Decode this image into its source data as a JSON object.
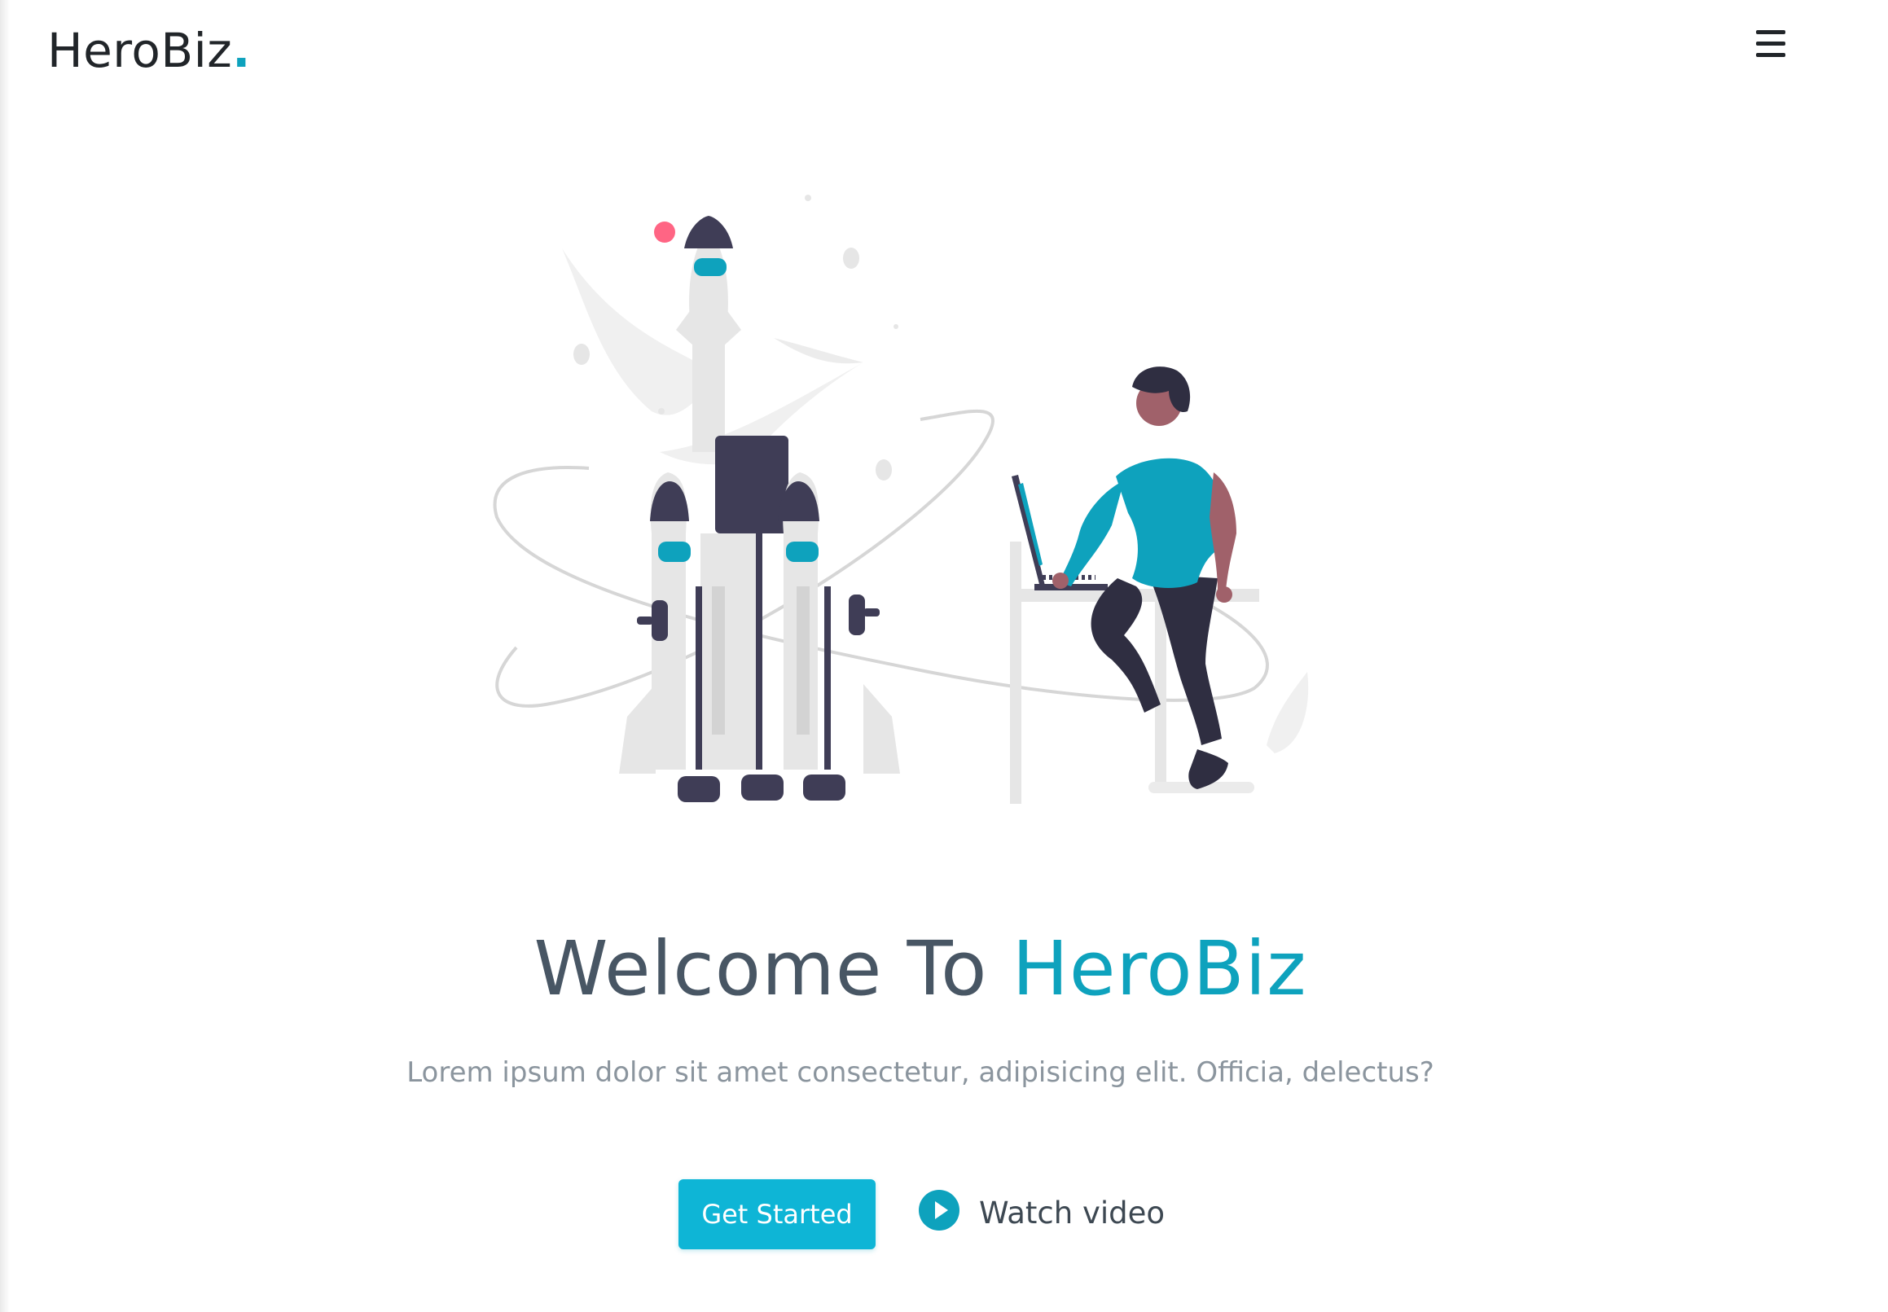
{
  "brand": {
    "name": "HeroBiz",
    "dot": ".",
    "accent_color": "#0ea2bd"
  },
  "header": {
    "menu_icon": "hamburger-menu-icon"
  },
  "hero": {
    "illustration": "rocket-launch-person-laptop-illustration",
    "title_prefix": "Welcome To",
    "title_accent": "HeroBiz",
    "subtitle": "Lorem ipsum dolor sit amet consectetur, adipisicing elit. Officia, delectus?",
    "primary_button": "Get Started",
    "secondary_button": "Watch video",
    "secondary_icon": "play-circle-icon"
  }
}
